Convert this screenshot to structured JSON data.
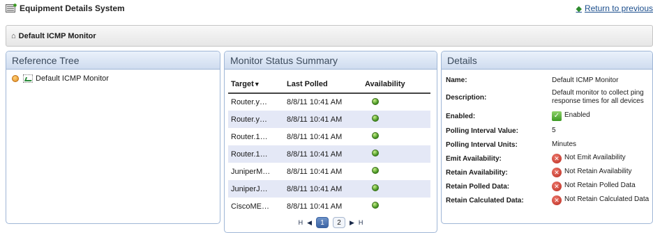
{
  "app": {
    "title": "Equipment Details System",
    "icon": "equipment-icon"
  },
  "return_link": {
    "label": "Return to previous",
    "icon": "back-arrow-icon"
  },
  "breadcrumb": {
    "label": "Default ICMP Monitor",
    "icon": "home-icon"
  },
  "reference_tree": {
    "title": "Reference Tree",
    "items": [
      {
        "label": "Default ICMP Monitor",
        "icon": "monitor-icon"
      }
    ]
  },
  "monitor_status": {
    "title": "Monitor Status Summary",
    "columns": {
      "target": "Target",
      "sort_indicator": "▼",
      "last_polled": "Last Polled",
      "availability": "Availability"
    },
    "rows": [
      {
        "target": "Router.y…",
        "last_polled": "8/8/11 10:41 AM",
        "availability": "green"
      },
      {
        "target": "Router.y…",
        "last_polled": "8/8/11 10:41 AM",
        "availability": "green"
      },
      {
        "target": "Router.1…",
        "last_polled": "8/8/11 10:41 AM",
        "availability": "green"
      },
      {
        "target": "Router.1…",
        "last_polled": "8/8/11 10:41 AM",
        "availability": "green"
      },
      {
        "target": "JuniperM…",
        "last_polled": "8/8/11 10:41 AM",
        "availability": "green"
      },
      {
        "target": "JuniperJ…",
        "last_polled": "8/8/11 10:41 AM",
        "availability": "green"
      },
      {
        "target": "CiscoME…",
        "last_polled": "8/8/11 10:41 AM",
        "availability": "green"
      }
    ],
    "pager": {
      "first": "H",
      "prev": "◀",
      "pages": [
        "1",
        "2"
      ],
      "current_page": "1",
      "next": "▶",
      "last": "H"
    }
  },
  "details": {
    "title": "Details",
    "rows": [
      {
        "label": "Name:",
        "value": "Default ICMP Monitor",
        "icon": ""
      },
      {
        "label": "Description:",
        "value": "Default monitor to collect ping response times for all devices",
        "icon": ""
      },
      {
        "label": "Enabled:",
        "value": "Enabled",
        "icon": "check-icon"
      },
      {
        "label": "Polling Interval Value:",
        "value": "5",
        "icon": ""
      },
      {
        "label": "Polling Interval Units:",
        "value": "Minutes",
        "icon": ""
      },
      {
        "label": "Emit Availability:",
        "value": "Not Emit Availability",
        "icon": "x-icon"
      },
      {
        "label": "Retain Availability:",
        "value": "Not Retain Availability",
        "icon": "x-icon"
      },
      {
        "label": "Retain Polled Data:",
        "value": "Not Retain Polled Data",
        "icon": "x-icon"
      },
      {
        "label": "Retain Calculated Data:",
        "value": "Not Retain Calculated Data",
        "icon": "x-icon"
      }
    ]
  },
  "colors": {
    "panel_border": "#9fb6d6",
    "panel_header": "#cfdcef",
    "row_alt": "#e4e8f6",
    "status_ok": "#3e8f1c",
    "status_no": "#b8281c",
    "link": "#1a4d8c"
  }
}
